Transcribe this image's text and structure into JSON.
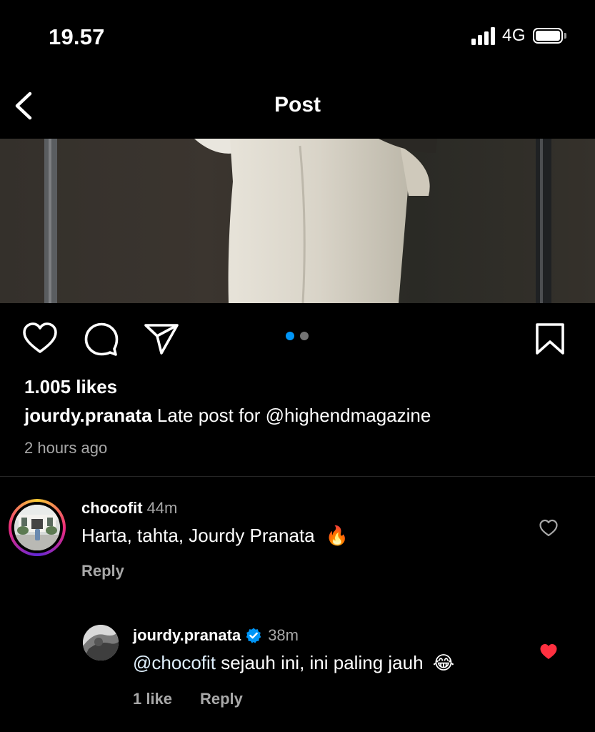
{
  "status_bar": {
    "time": "19.57",
    "network": "4G"
  },
  "header": {
    "title": "Post"
  },
  "carousel": {
    "active_dot_color": "#0095f6",
    "inactive_dot_color": "#737373"
  },
  "post": {
    "likes": "1.005 likes",
    "author": "jourdy.pranata",
    "caption": "Late post for @highendmagazine",
    "time_ago": "2 hours ago"
  },
  "comments": [
    {
      "username": "chocofit",
      "time": "44m",
      "text": "Harta, tahta, Jourdy Pranata",
      "emoji": "🔥",
      "reply_label": "Reply"
    }
  ],
  "reply": {
    "username": "jourdy.pranata",
    "time": "38m",
    "mention": "@chocofit",
    "text": " sejauh ini, ini paling jauh",
    "emoji": "😂",
    "likes_label": "1 like",
    "reply_label": "Reply",
    "liked_color": "#ff3040"
  },
  "icons": {
    "back": "chevron-left-icon",
    "like": "heart-icon",
    "comment": "comment-bubble-icon",
    "share": "paper-plane-icon",
    "save": "bookmark-icon",
    "verified": "verified-badge-icon"
  }
}
